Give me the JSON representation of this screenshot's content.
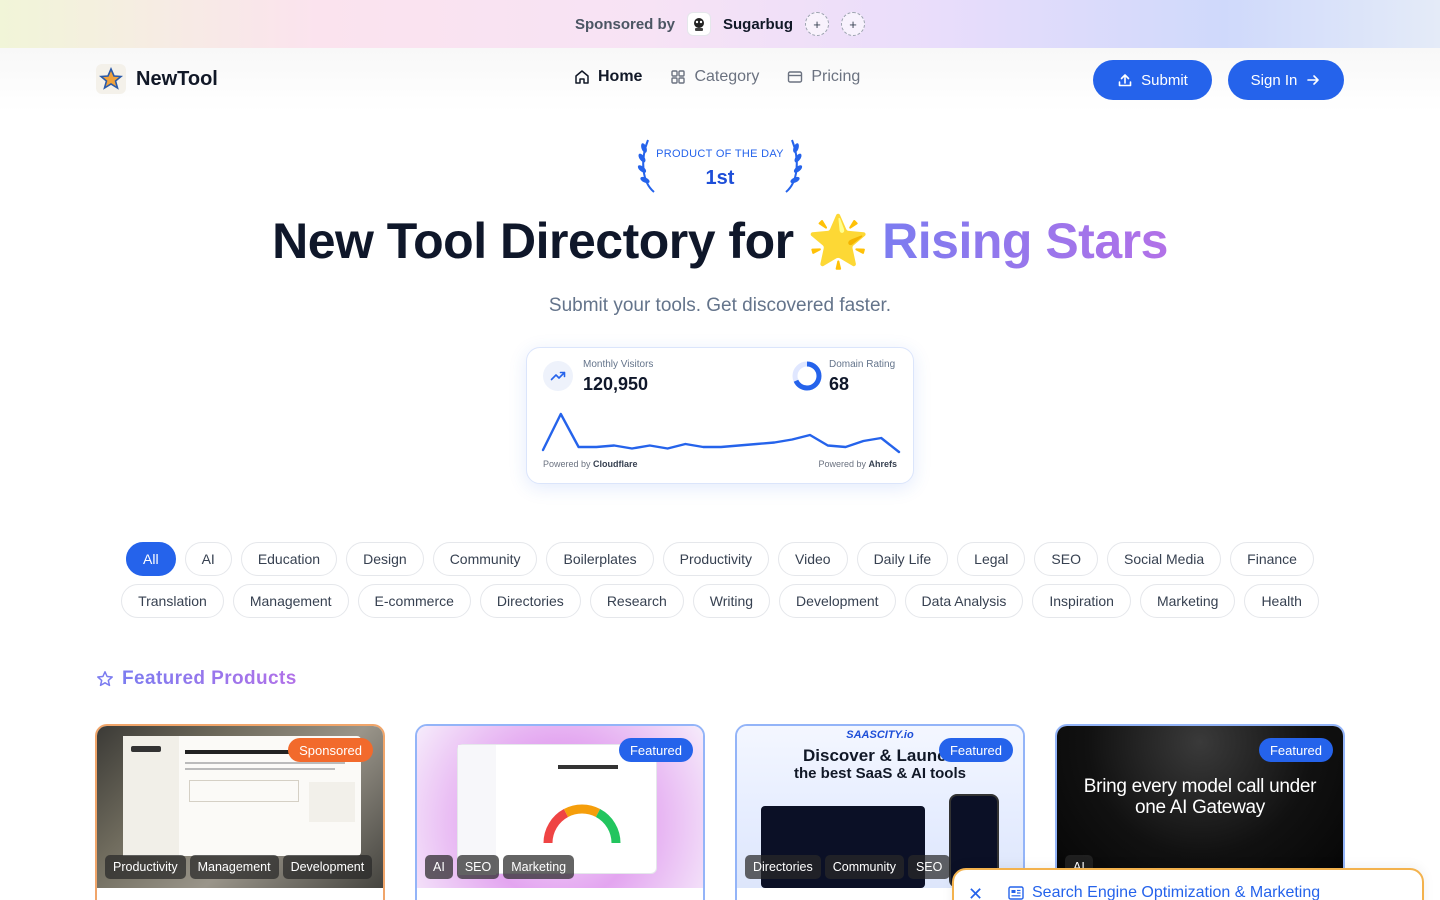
{
  "sponsor": {
    "label": "Sponsored by",
    "name": "Sugarbug",
    "plus1": "+",
    "plus2": "+"
  },
  "header": {
    "logo_text": "NewTool",
    "nav": [
      {
        "label": "Home",
        "icon": "home-icon",
        "active": true
      },
      {
        "label": "Category",
        "icon": "grid-icon",
        "active": false
      },
      {
        "label": "Pricing",
        "icon": "card-icon",
        "active": false
      }
    ],
    "submit_label": "Submit",
    "signin_label": "Sign In"
  },
  "hero": {
    "badge_small": "PRODUCT OF THE DAY",
    "badge_big": "1st",
    "title_main": "New Tool Directory for",
    "title_emoji": "🌟",
    "title_highlight": "Rising Stars",
    "subtitle": "Submit your tools. Get discovered faster."
  },
  "stats": {
    "visitors_label": "Monthly Visitors",
    "visitors_value": "120,950",
    "rating_label": "Domain Rating",
    "rating_value": "68",
    "rating_fraction": 0.68,
    "powered_left_prefix": "Powered by",
    "powered_left_brand": "Cloudflare",
    "powered_right_prefix": "Powered by",
    "powered_right_brand": "Ahrefs",
    "sparkline": [
      28,
      4,
      26,
      26,
      25,
      27,
      25,
      27,
      24,
      26,
      26,
      25,
      24,
      23,
      21,
      18,
      25,
      26,
      22,
      20,
      30
    ]
  },
  "categories": {
    "row1": [
      "All",
      "AI",
      "Education",
      "Design",
      "Community",
      "Boilerplates",
      "Productivity",
      "Video",
      "Daily Life",
      "Legal",
      "SEO",
      "Social Media",
      "Finance"
    ],
    "row2": [
      "Translation",
      "Management",
      "E-commerce",
      "Directories",
      "Research",
      "Writing",
      "Development",
      "Data Analysis",
      "Inspiration",
      "Marketing",
      "Health"
    ],
    "active": "All"
  },
  "featured": {
    "title": "Featured Products",
    "cards": [
      {
        "tag": "Sponsored",
        "cats": [
          "Productivity",
          "Management",
          "Development"
        ]
      },
      {
        "tag": "Featured",
        "cats": [
          "AI",
          "SEO",
          "Marketing"
        ]
      },
      {
        "tag": "Featured",
        "cats": [
          "Directories",
          "Community",
          "SEO"
        ],
        "headline_brand": "SAASCITY.io",
        "headline_1": "Discover & Launch",
        "headline_2": "the best SaaS & AI tools"
      },
      {
        "tag": "Featured",
        "cats": [
          "AI"
        ],
        "headline_1": "Bring every model call under",
        "headline_2": "one AI Gateway"
      }
    ]
  },
  "floating": {
    "text": "Search Engine Optimization & Marketing"
  },
  "colors": {
    "primary": "#2563eb",
    "sponsored_tag": "#f26a2c",
    "gradient_start": "#7c7cf0",
    "gradient_end": "#b271e8"
  }
}
